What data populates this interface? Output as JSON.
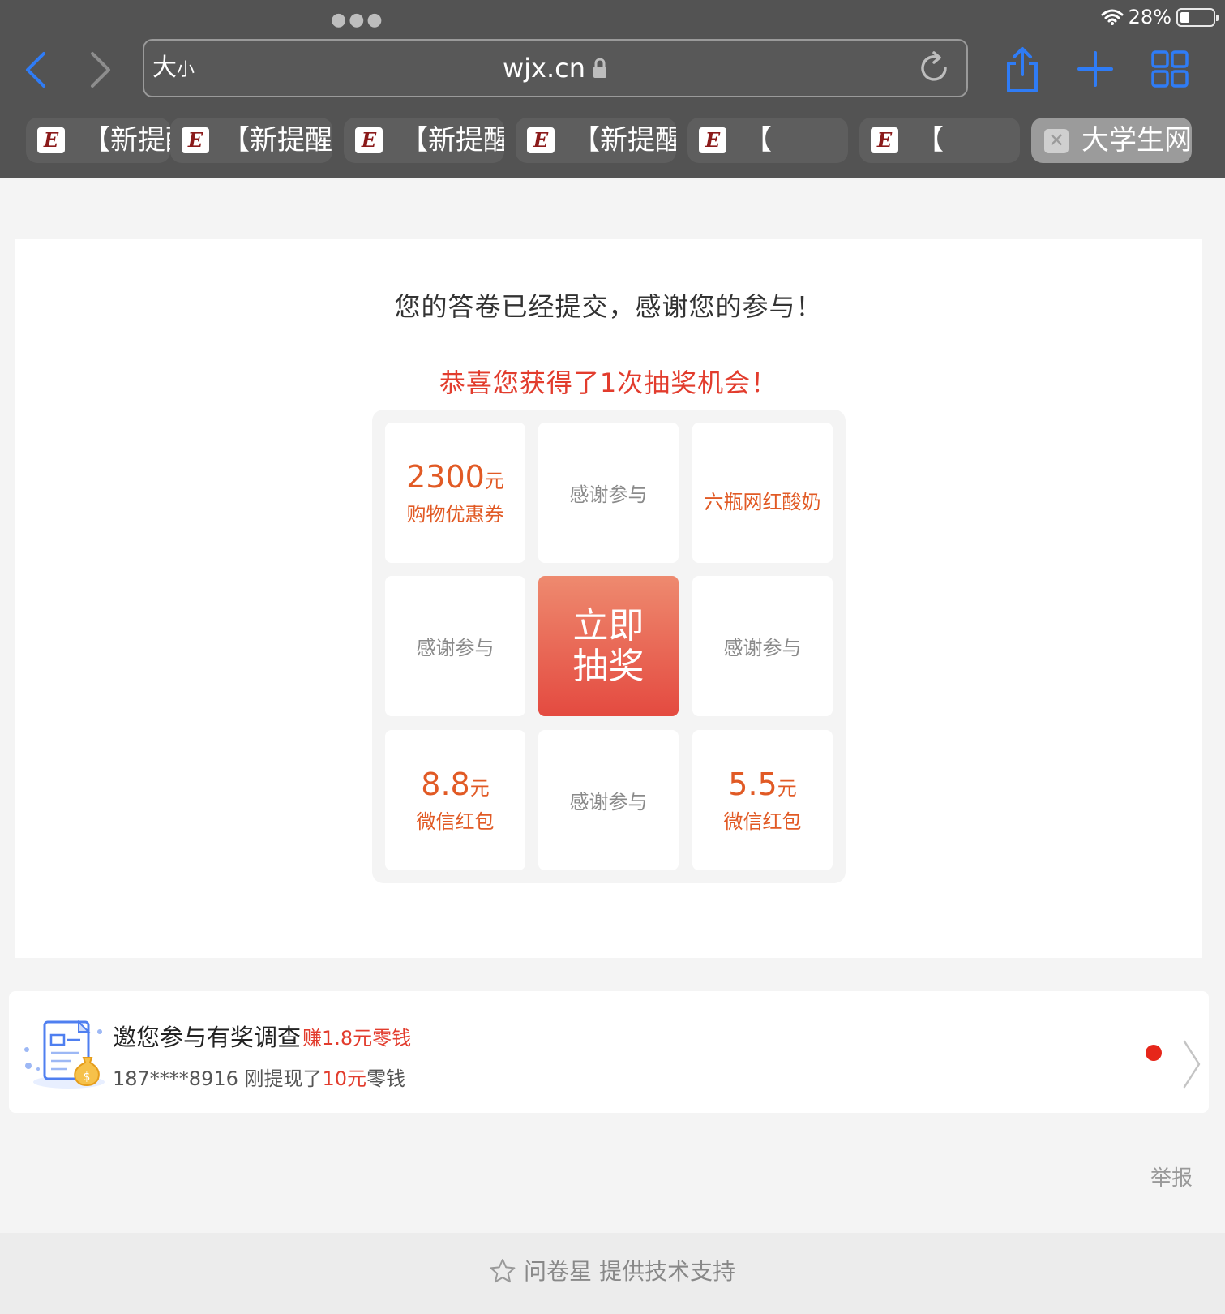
{
  "status_bar": {
    "battery": "28%",
    "battery_level": 0.28
  },
  "browser": {
    "text_size_label_large": "大",
    "text_size_label_small": "小",
    "url": "wjx.cn",
    "tabs": [
      {
        "favicon": "E",
        "title": "【新提醒"
      },
      {
        "favicon": "E",
        "title": "【新提醒"
      },
      {
        "favicon": "E",
        "title": "【新提醒"
      },
      {
        "favicon": "E",
        "title": "【新提醒"
      },
      {
        "favicon": "E",
        "title": "【"
      },
      {
        "favicon": "E",
        "title": "【"
      },
      {
        "favicon": "close-icon",
        "title": "大学生网",
        "active": true
      }
    ]
  },
  "result": {
    "thanks": "您的答卷已经提交，感谢您的参与！",
    "congrats": "恭喜您获得了1次抽奖机会！"
  },
  "lottery": {
    "draw_button": {
      "line1": "立即",
      "line2": "抽奖"
    },
    "cells": [
      {
        "amount": "2300",
        "unit": "元",
        "desc": "购物优惠券"
      },
      {
        "text": "感谢参与"
      },
      {
        "text": "六瓶网红酸奶"
      },
      {
        "text": "感谢参与"
      },
      {
        "text": "感谢参与"
      },
      {
        "amount": "8.8",
        "unit": "元",
        "desc": "微信红包"
      },
      {
        "text": "感谢参与"
      },
      {
        "amount": "5.5",
        "unit": "元",
        "desc": "微信红包"
      }
    ]
  },
  "survey_invite": {
    "title": "邀您参与有奖调查",
    "reward": "赚1.8元零钱",
    "status_prefix": "187****8916 刚提现了",
    "status_amount": "10元",
    "status_suffix": "零钱"
  },
  "report_label": "举报",
  "footer": {
    "text": "问卷星 提供技术支持"
  },
  "colors": {
    "accent_red": "#e23c2d",
    "prize_orange": "#e15a25",
    "draw_button_top": "#ee8a6f",
    "draw_button_bottom": "#e44a40",
    "ios_blue": "#2f7cf6"
  }
}
